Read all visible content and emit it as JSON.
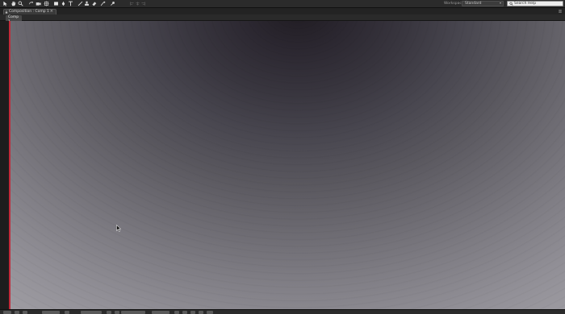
{
  "toolbar": {
    "tools": [
      {
        "name": "selection-tool-icon"
      },
      {
        "name": "hand-tool-icon"
      },
      {
        "name": "zoom-tool-icon"
      },
      {
        "name": "rotation-tool-icon"
      },
      {
        "name": "camera-tool-icon"
      },
      {
        "name": "pan-behind-tool-icon"
      },
      {
        "name": "rectangle-tool-icon"
      },
      {
        "name": "pen-tool-icon"
      },
      {
        "name": "type-tool-icon"
      },
      {
        "name": "brush-tool-icon"
      },
      {
        "name": "clone-stamp-tool-icon"
      },
      {
        "name": "eraser-tool-icon"
      },
      {
        "name": "roto-brush-tool-icon"
      },
      {
        "name": "puppet-pin-tool-icon"
      }
    ],
    "workspace_label": "Workspace:",
    "workspace_value": "Standard",
    "search_placeholder": "Search Help"
  },
  "panel": {
    "tab_label": "Composition : Comp 1",
    "close_glyph": "×"
  },
  "comp_tabs": [
    {
      "label": "Comp 1"
    }
  ],
  "colors": {
    "accent_red": "#c12a3a",
    "ui_dark": "#2b2b2b"
  }
}
